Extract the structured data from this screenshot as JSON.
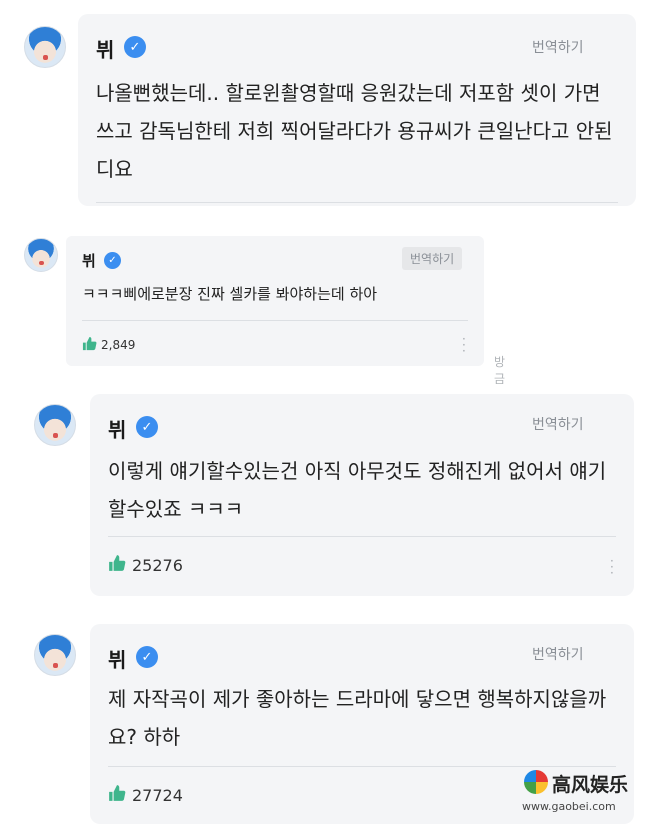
{
  "comments": [
    {
      "name": "뷔",
      "translate_label": "번역하기",
      "text": "나올뻔했는데.. 할로윈촬영할때 응원갔는데 저포함 셋이 가면쓰고 감독님한테 저희 찍어달라다가 용규씨가 큰일난다고 안된디요",
      "likes": ""
    },
    {
      "name": "뷔",
      "translate_label": "번역하기",
      "text": "ㅋㅋㅋ삐에로분장 진짜 셀카를 봐야하는데 하아",
      "likes": "2,849",
      "reply_label": "방금"
    },
    {
      "name": "뷔",
      "translate_label": "번역하기",
      "text": "이렇게 얘기할수있는건 아직 아무것도 정해진게 없어서 얘기할수있죠 ㅋㅋㅋ",
      "likes": "25276"
    },
    {
      "name": "뷔",
      "translate_label": "번역하기",
      "text": "제 자작곡이 제가 좋아하는 드라마에 닿으면 행복하지않을까요? 하하",
      "likes": "27724"
    }
  ],
  "watermark": {
    "title": "高风娱乐",
    "url": "www.gaobei.com"
  },
  "colors": {
    "bubble": "#f4f5f7",
    "badge": "#3b8ef0",
    "thumb": "#3fb58c",
    "muted": "#8a8f96"
  },
  "icons": {
    "verified": "check-badge-icon",
    "like": "thumbs-up-icon",
    "more": "vertical-ellipsis-icon"
  }
}
